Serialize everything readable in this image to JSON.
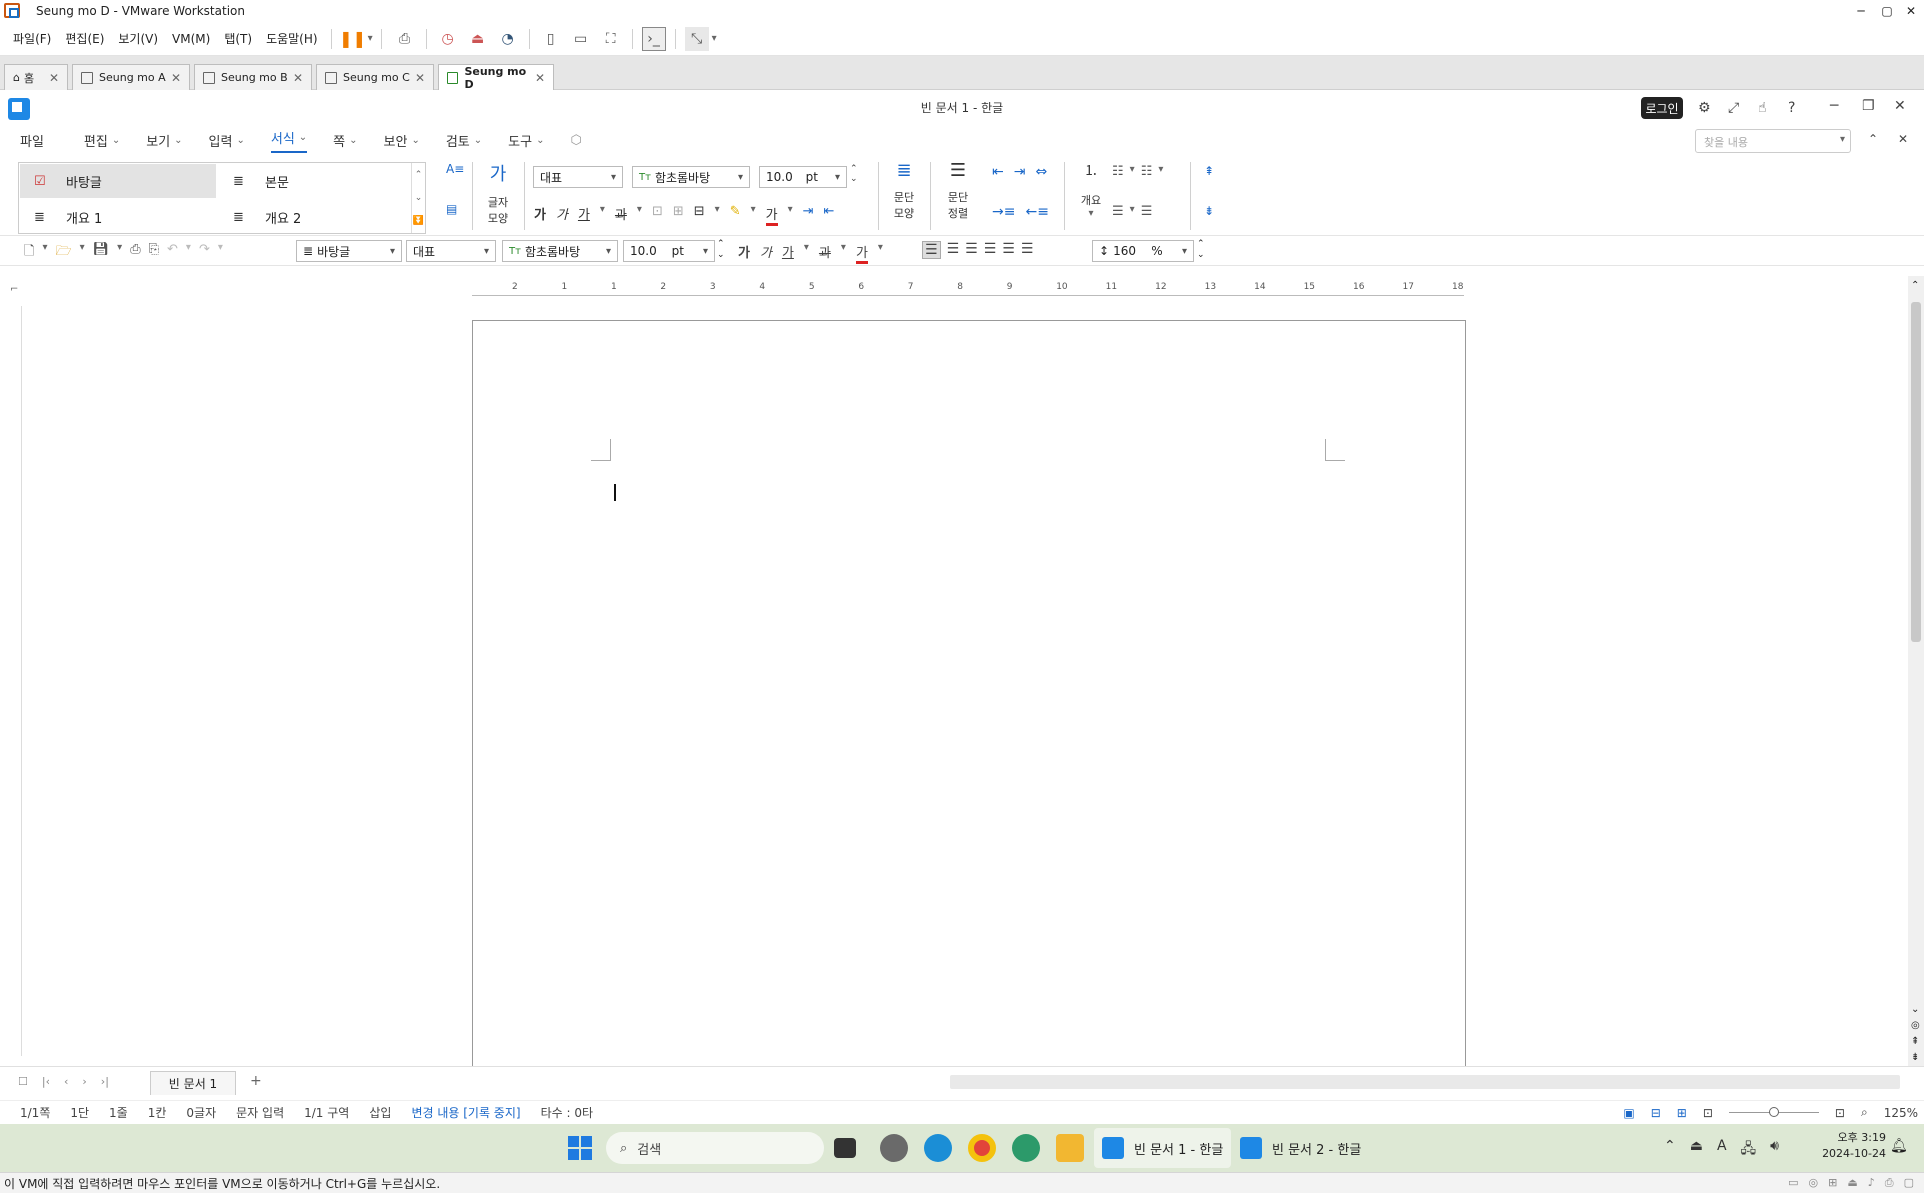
{
  "vmware": {
    "window_title": "Seung mo D - VMware Workstation",
    "menu": [
      "파일(F)",
      "편집(E)",
      "보기(V)",
      "VM(M)",
      "탭(T)",
      "도움말(H)"
    ],
    "tabs": [
      {
        "label": "홈",
        "icon": "home-icon"
      },
      {
        "label": "Seung mo A",
        "icon": "vm-icon"
      },
      {
        "label": "Seung mo B",
        "icon": "vm-icon"
      },
      {
        "label": "Seung mo C",
        "icon": "vm-icon"
      },
      {
        "label": "Seung mo D",
        "icon": "vm-running-icon",
        "active": true
      }
    ],
    "status_message": "이 VM에 직접 입력하려면 마우스 포인터를 VM으로 이동하거나 Ctrl+G를 누르십시오."
  },
  "hwp": {
    "title": "빈 문서 1 - 한글",
    "login_label": "로그인",
    "menu": [
      "파일",
      "편집",
      "보기",
      "입력",
      "서식",
      "쪽",
      "보안",
      "검토",
      "도구"
    ],
    "active_menu": "서식",
    "search_placeholder": "찾을 내용",
    "styles": [
      "바탕글",
      "본문",
      "개요 1",
      "개요 2"
    ],
    "ribbon": {
      "char_shape_label": "글자\n모양",
      "char_shape_l1": "글자",
      "char_shape_l2": "모양",
      "font_category": "대표",
      "font_name": "함초롬바탕",
      "font_size": "10.0",
      "font_unit": "pt",
      "para_shape_l1": "문단",
      "para_shape_l2": "모양",
      "para_align_l1": "문단",
      "para_align_l2": "정렬",
      "outline_label": "개요",
      "glyph_bold": "가",
      "glyph_italic": "가",
      "glyph_underline": "가",
      "glyph_strike": "과",
      "glyph_char": "가"
    },
    "quickbar": {
      "style": "바탕글",
      "font_category": "대표",
      "font_name": "함초롬바탕",
      "font_size": "10.0",
      "font_unit": "pt",
      "line_spacing": "160",
      "line_spacing_unit": "%"
    },
    "ruler_h_labels": [
      "2",
      "1",
      "1",
      "2",
      "3",
      "4",
      "5",
      "6",
      "7",
      "8",
      "9",
      "10",
      "11",
      "12",
      "13",
      "14",
      "15",
      "16",
      "17",
      "18"
    ],
    "sheet_tab": "빈 문서 1",
    "status": {
      "page": "1/1쪽",
      "column": "1단",
      "line": "1줄",
      "cell": "1칸",
      "chars": "0글자",
      "mode": "문자 입력",
      "section": "1/1 구역",
      "insert": "삽입",
      "track_changes": "변경 내용 [기록 중지]",
      "typing": "타수 : 0타",
      "zoom": "125%"
    }
  },
  "taskbar": {
    "search_label": "검색",
    "apps": [
      {
        "label": "빈 문서 1 - 한글",
        "active": true
      },
      {
        "label": "빈 문서 2 - 한글",
        "active": false
      }
    ],
    "time": "오후 3:19",
    "date": "2024-10-24",
    "ime": "A"
  },
  "colors": {
    "accent": "#1a67c8",
    "vm_pause": "#f07d00",
    "taskbar_bg": "#dde8d4"
  }
}
